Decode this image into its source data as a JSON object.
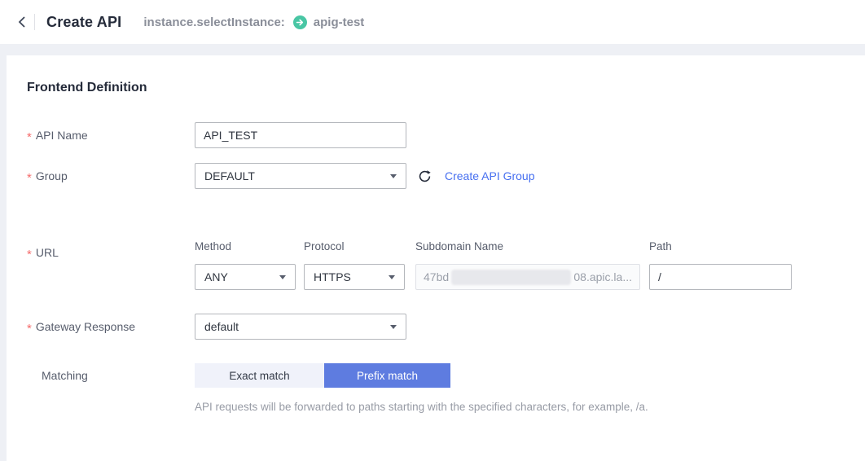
{
  "header": {
    "title": "Create API",
    "breadcrumb_label": "instance.selectInstance:",
    "instance_name": "apig-test"
  },
  "section": {
    "title": "Frontend Definition"
  },
  "required_marker": "*",
  "form": {
    "api_name": {
      "label": "API Name",
      "value": "API_TEST"
    },
    "group": {
      "label": "Group",
      "value": "DEFAULT",
      "create_link_label": "Create API Group"
    },
    "url": {
      "label": "URL",
      "method": {
        "label": "Method",
        "value": "ANY"
      },
      "protocol": {
        "label": "Protocol",
        "value": "HTTPS"
      },
      "subdomain": {
        "label": "Subdomain Name",
        "value_prefix": "47bd",
        "value_suffix": "08.apic.la..."
      },
      "path": {
        "label": "Path",
        "value": "/"
      }
    },
    "gateway_response": {
      "label": "Gateway Response",
      "value": "default"
    },
    "matching": {
      "label": "Matching",
      "options": [
        "Exact match",
        "Prefix match"
      ],
      "selected": "Prefix match",
      "help": "API requests will be forwarded to paths starting with the specified characters, for example, /a."
    }
  },
  "colors": {
    "accent_blue": "#5e7ce0",
    "link_blue": "#466ff0",
    "status_green": "#49c6a4",
    "required_red": "#f56c6c",
    "page_background": "#eef0f5"
  }
}
